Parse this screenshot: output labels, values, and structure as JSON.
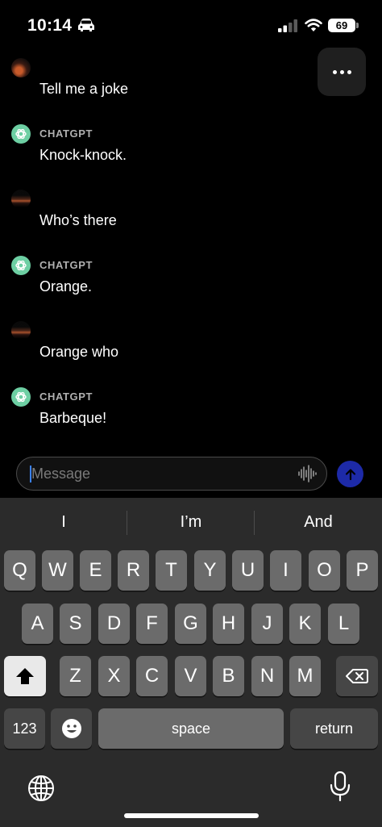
{
  "status_bar": {
    "time": "10:14",
    "battery": "69"
  },
  "messages": [
    {
      "role": "user",
      "sender": "",
      "text": "Tell me a joke"
    },
    {
      "role": "assistant",
      "sender": "CHATGPT",
      "text": "Knock-knock."
    },
    {
      "role": "user",
      "sender": "",
      "text": "Who’s there"
    },
    {
      "role": "assistant",
      "sender": "CHATGPT",
      "text": "Orange."
    },
    {
      "role": "user",
      "sender": "",
      "text": "Orange who"
    },
    {
      "role": "assistant",
      "sender": "CHATGPT",
      "text": "Barbeque!"
    }
  ],
  "composer": {
    "placeholder": "Message"
  },
  "keyboard": {
    "suggestions": [
      "I",
      "I’m",
      "And"
    ],
    "row1": [
      "Q",
      "W",
      "E",
      "R",
      "T",
      "Y",
      "U",
      "I",
      "O",
      "P"
    ],
    "row2": [
      "A",
      "S",
      "D",
      "F",
      "G",
      "H",
      "J",
      "K",
      "L"
    ],
    "row3": [
      "Z",
      "X",
      "C",
      "V",
      "B",
      "N",
      "M"
    ],
    "numbers_key": "123",
    "space_key": "space",
    "return_key": "return"
  },
  "colors": {
    "accent": "#1d2aa8",
    "gpt_avatar": "#6dcfa3",
    "cursor": "#3b82f6"
  }
}
